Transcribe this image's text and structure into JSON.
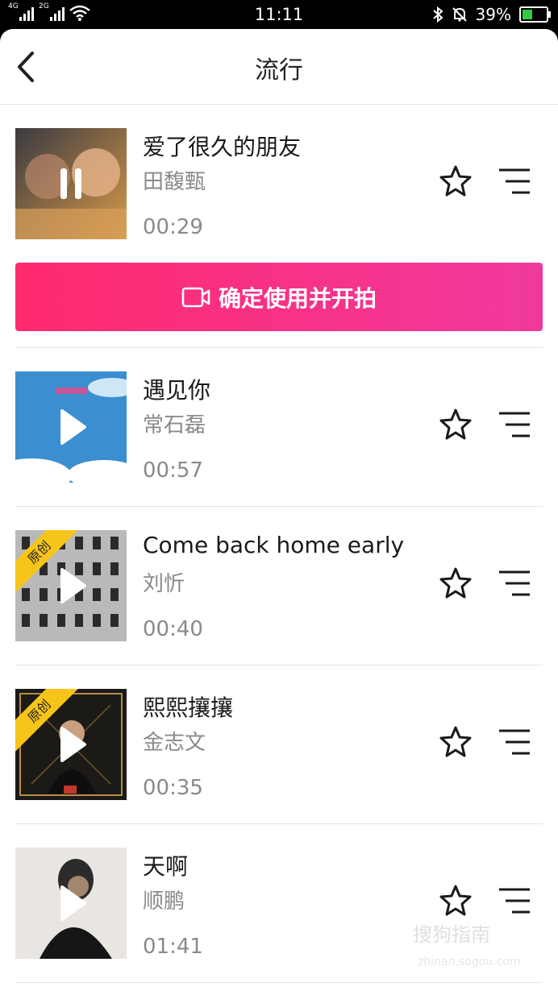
{
  "status": {
    "net1": "4G",
    "net2": "2G",
    "time": "11:11",
    "battery": "39%",
    "battery_level": 0.39
  },
  "header": {
    "title": "流行"
  },
  "songs": [
    {
      "title": "爱了很久的朋友",
      "artist": "田馥甄",
      "duration": "00:29",
      "state": "playing",
      "badge": ""
    },
    {
      "title": "遇见你",
      "artist": "常石磊",
      "duration": "00:57",
      "state": "paused",
      "badge": ""
    },
    {
      "title": "Come back home early",
      "artist": "刘忻",
      "duration": "00:40",
      "state": "paused",
      "badge": "原创"
    },
    {
      "title": "熙熙攘攘",
      "artist": "金志文",
      "duration": "00:35",
      "state": "paused",
      "badge": "原创"
    },
    {
      "title": "天啊",
      "artist": "顺鹏",
      "duration": "01:41",
      "state": "paused",
      "badge": ""
    }
  ],
  "use_button": {
    "label": "确定使用并开拍"
  },
  "colors": {
    "accent": "#ff2a6e",
    "badge": "#f7c51a"
  },
  "watermark": {
    "text": "搜狗指南",
    "sub": "zhinan.sogou.com"
  }
}
